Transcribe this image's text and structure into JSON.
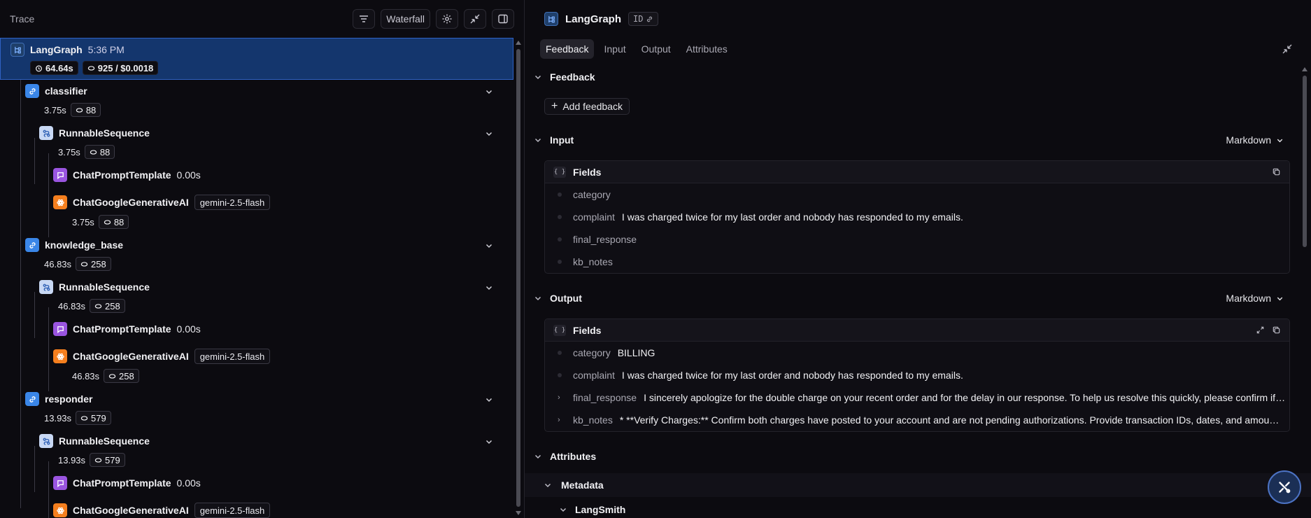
{
  "left": {
    "title": "Trace",
    "view_button": "Waterfall",
    "root": {
      "name": "LangGraph",
      "time": "5:36 PM",
      "duration": "64.64s",
      "tokens": "925 / $0.0018"
    },
    "nodes": [
      {
        "name": "classifier",
        "duration": "3.75s",
        "tokens": "88"
      },
      {
        "name": "RunnableSequence",
        "duration": "3.75s",
        "tokens": "88"
      },
      {
        "name": "ChatPromptTemplate",
        "duration": "0.00s"
      },
      {
        "name": "ChatGoogleGenerativeAI",
        "model": "gemini-2.5-flash",
        "duration": "3.75s",
        "tokens": "88"
      },
      {
        "name": "knowledge_base",
        "duration": "46.83s",
        "tokens": "258"
      },
      {
        "name": "RunnableSequence",
        "duration": "46.83s",
        "tokens": "258"
      },
      {
        "name": "ChatPromptTemplate",
        "duration": "0.00s"
      },
      {
        "name": "ChatGoogleGenerativeAI",
        "model": "gemini-2.5-flash",
        "duration": "46.83s",
        "tokens": "258"
      },
      {
        "name": "responder",
        "duration": "13.93s",
        "tokens": "579"
      },
      {
        "name": "RunnableSequence",
        "duration": "13.93s",
        "tokens": "579"
      },
      {
        "name": "ChatPromptTemplate",
        "duration": "0.00s"
      },
      {
        "name": "ChatGoogleGenerativeAI",
        "model": "gemini-2.5-flash"
      }
    ]
  },
  "right": {
    "title": "LangGraph",
    "id_label": "ID",
    "tabs": [
      "Feedback",
      "Input",
      "Output",
      "Attributes"
    ],
    "feedback": {
      "label": "Feedback",
      "add_label": "Add feedback"
    },
    "input": {
      "label": "Input",
      "format": "Markdown",
      "card_title": "Fields",
      "fields": [
        {
          "key": "category",
          "value": ""
        },
        {
          "key": "complaint",
          "value": "I was charged twice for my last order and nobody has responded to my emails."
        },
        {
          "key": "final_response",
          "value": ""
        },
        {
          "key": "kb_notes",
          "value": ""
        }
      ]
    },
    "output": {
      "label": "Output",
      "format": "Markdown",
      "card_title": "Fields",
      "fields": [
        {
          "key": "category",
          "value": "BILLING"
        },
        {
          "key": "complaint",
          "value": "I was charged twice for my last order and nobody has responded to my emails."
        },
        {
          "key": "final_response",
          "value": "I sincerely apologize for the double charge on your recent order and for the delay in our response. To help us resolve this quickly, please confirm if both c..."
        },
        {
          "key": "kb_notes",
          "value": "* **Verify Charges:** Confirm both charges have posted to your account and are not pending authorizations. Provide transaction IDs, dates, and amounts for b..."
        }
      ]
    },
    "attributes": {
      "label": "Attributes",
      "metadata_label": "Metadata",
      "langsmith_label": "LangSmith"
    }
  },
  "colors": {
    "selected_row": "#14366d",
    "chain_icon": "#3a86e8",
    "prompt_icon": "#9a55e0",
    "llm_icon": "#f57f1e"
  }
}
